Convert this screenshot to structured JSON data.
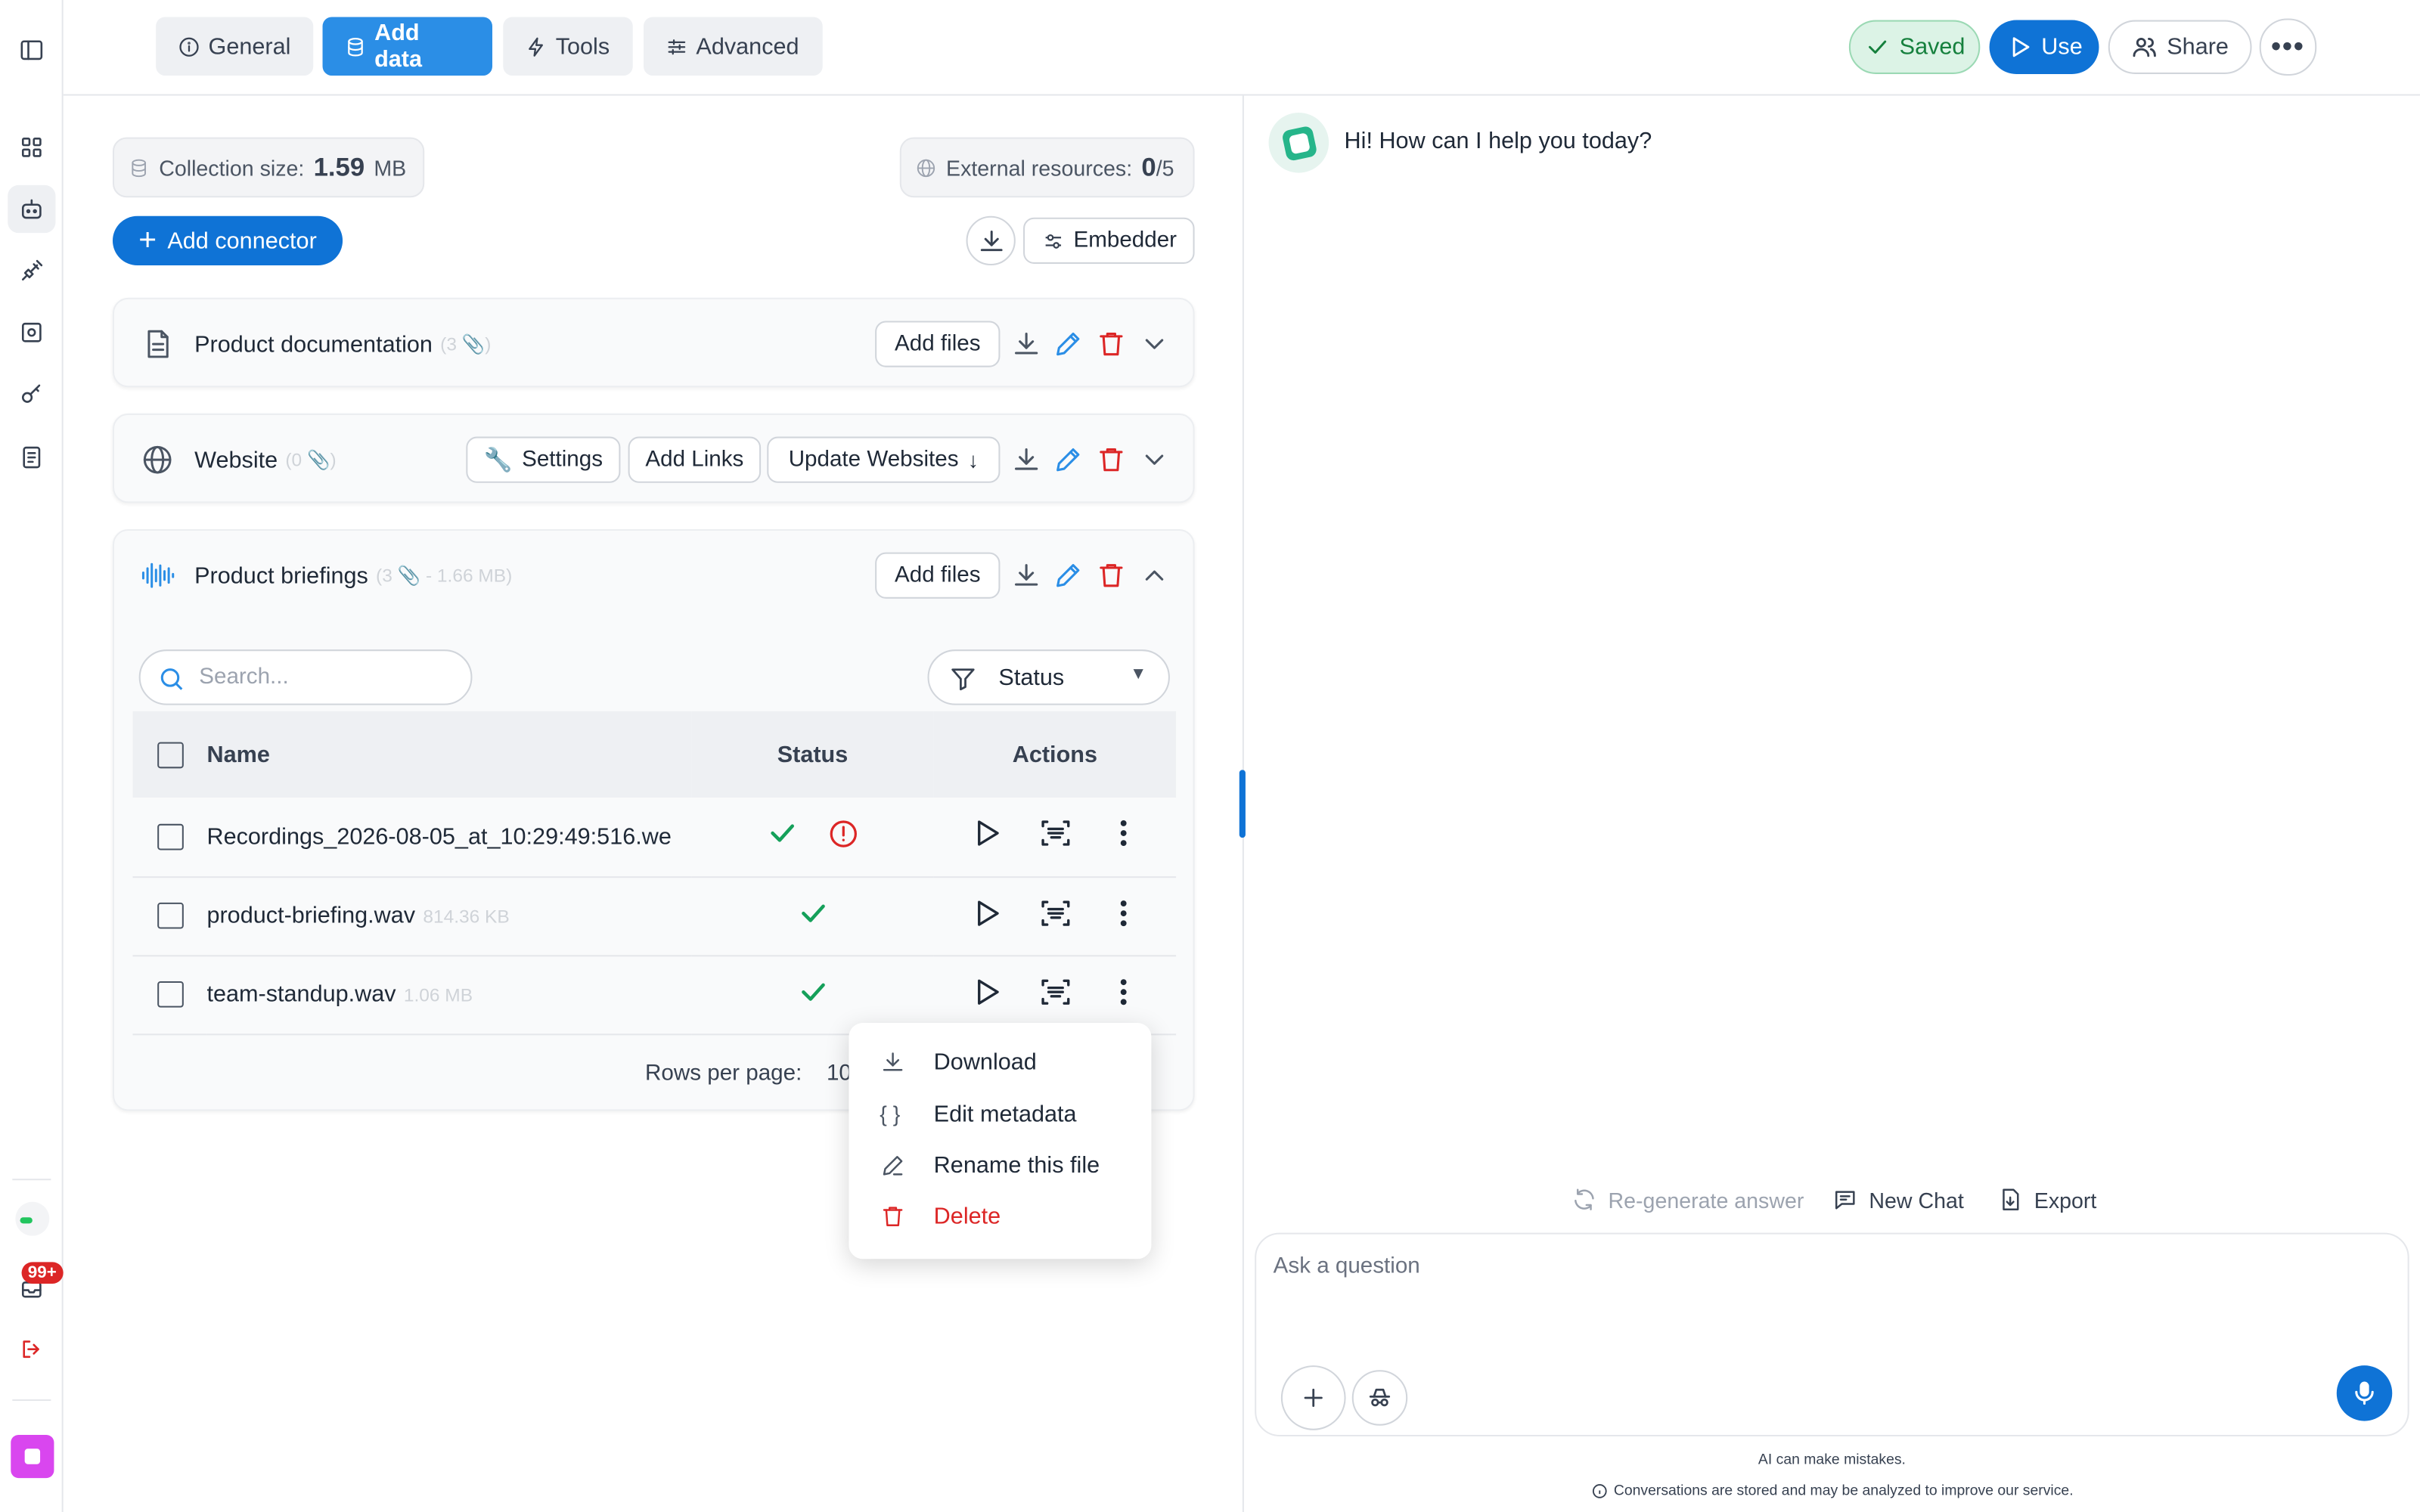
{
  "topbar": {
    "tabs": [
      {
        "label": "General",
        "icon": "info-icon"
      },
      {
        "label": "Add data",
        "icon": "database-icon",
        "active": true
      },
      {
        "label": "Tools",
        "icon": "bolt-icon"
      },
      {
        "label": "Advanced",
        "icon": "sliders-icon"
      }
    ],
    "saved_label": "Saved",
    "use_label": "Use",
    "share_label": "Share"
  },
  "sidebar": {
    "notification_count": "99+"
  },
  "collection": {
    "size_label": "Collection size:",
    "size_value": "1.59",
    "size_unit": "MB",
    "external_label": "External resources:",
    "external_value": "0",
    "external_total": "/5",
    "add_connector_label": "Add connector",
    "embedder_label": "Embedder"
  },
  "sources": [
    {
      "name": "Product documentation",
      "meta": "(3 📎)",
      "add_files_label": "Add files"
    },
    {
      "name": "Website",
      "meta": "(0 📎)",
      "settings_label": "Settings",
      "add_links_label": "Add Links",
      "update_label": "Update Websites"
    },
    {
      "name": "Product briefings",
      "meta": "(3 📎 - 1.66 MB)",
      "add_files_label": "Add files"
    }
  ],
  "files": {
    "search_placeholder": "Search...",
    "status_filter_label": "Status",
    "columns": [
      "Name",
      "Status",
      "Actions"
    ],
    "rows": [
      {
        "name": "Recordings_2026-08-05_at_10:29:49:516.we",
        "size": "",
        "status": "ok-warning"
      },
      {
        "name": "product-briefing.wav",
        "size": "814.36 KB",
        "status": "ok"
      },
      {
        "name": "team-standup.wav",
        "size": "1.06 MB",
        "status": "ok"
      }
    ],
    "rows_per_page_label": "Rows per page:",
    "rows_per_page_value": "10"
  },
  "context_menu": {
    "items": [
      {
        "label": "Download",
        "icon": "download-icon"
      },
      {
        "label": "Edit metadata",
        "icon": "braces-icon"
      },
      {
        "label": "Rename this file",
        "icon": "pencil-icon"
      },
      {
        "label": "Delete",
        "icon": "trash-icon",
        "danger": true
      }
    ]
  },
  "chat": {
    "greeting": "Hi! How can I help you today?",
    "regenerate_label": "Re-generate answer",
    "new_chat_label": "New Chat",
    "export_label": "Export",
    "input_placeholder": "Ask a question",
    "disclaimer": "AI can make mistakes.",
    "privacy_note": "Conversations are stored and may be analyzed to improve our service."
  },
  "colors": {
    "accent": "#0f73d6",
    "tab_active": "#2b8ee6",
    "success": "#15a05a",
    "danger": "#dc2626"
  }
}
